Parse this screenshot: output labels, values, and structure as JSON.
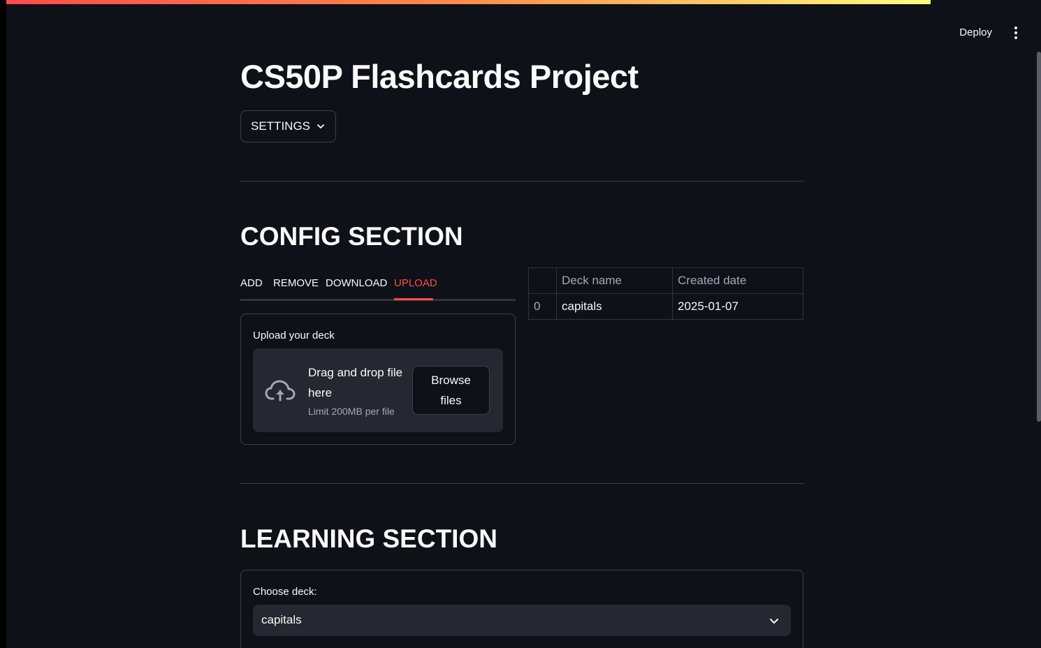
{
  "header": {
    "deploy_label": "Deploy",
    "menu_icon": "more-vertical-icon"
  },
  "page": {
    "title": "CS50P Flashcards Project"
  },
  "settings": {
    "label": "SETTINGS",
    "icon": "chevron-down-icon"
  },
  "config": {
    "title": "CONFIG SECTION",
    "tabs": [
      {
        "label": "ADD",
        "active": false
      },
      {
        "label": "REMOVE",
        "active": false
      },
      {
        "label": "DOWNLOAD",
        "active": false
      },
      {
        "label": "UPLOAD",
        "active": true
      }
    ],
    "upload": {
      "label": "Upload your deck",
      "drop_text": "Drag and drop file here",
      "limit_text": "Limit 200MB per file",
      "browse_label": "Browse files",
      "icon": "cloud-upload-icon"
    },
    "table": {
      "columns": [
        "",
        "Deck name",
        "Created date"
      ],
      "rows": [
        [
          "0",
          "capitals",
          "2025-01-07"
        ]
      ]
    }
  },
  "learning": {
    "title": "LEARNING SECTION",
    "choose_label": "Choose deck:",
    "selected_deck": "capitals"
  },
  "colors": {
    "background": "#0e1117",
    "accent": "#ff4b4b",
    "widget_background": "#262730",
    "border": "#3d4049"
  }
}
